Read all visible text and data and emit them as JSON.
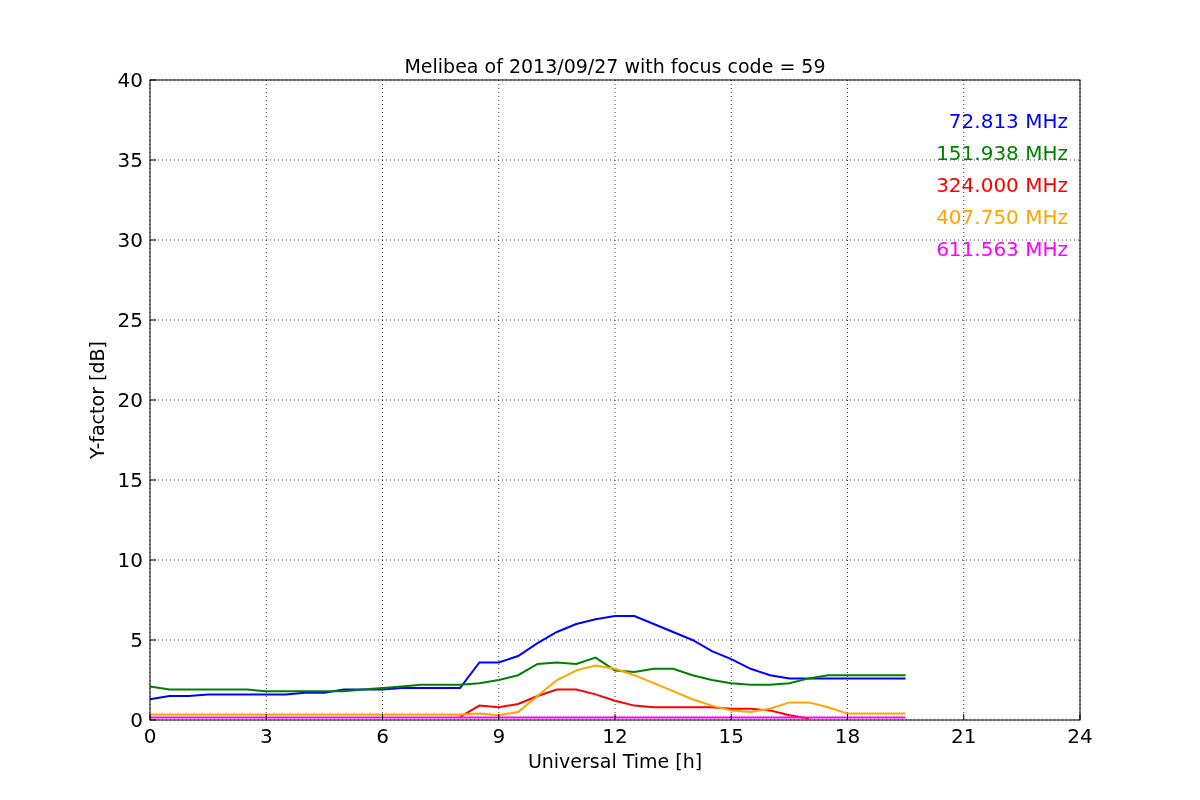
{
  "chart_data": {
    "type": "line",
    "title": "Melibea of 2013/09/27 with focus code = 59",
    "xlabel": "Universal Time [h]",
    "ylabel": "Y-factor [dB]",
    "x": [
      0,
      0.5,
      1,
      1.5,
      2,
      2.5,
      3,
      3.5,
      4,
      4.5,
      5,
      5.5,
      6,
      6.5,
      7,
      7.5,
      8,
      8.5,
      9,
      9.5,
      10,
      10.5,
      11,
      11.5,
      12,
      12.5,
      13,
      13.5,
      14,
      14.5,
      15,
      15.5,
      16,
      16.5,
      17,
      17.5,
      18,
      18.5,
      19,
      19.5
    ],
    "grid": true,
    "xlim": [
      0,
      24
    ],
    "ylim": [
      0,
      40
    ],
    "xticks": [
      0,
      3,
      6,
      9,
      12,
      15,
      18,
      21,
      24
    ],
    "yticks": [
      0,
      5,
      10,
      15,
      20,
      25,
      30,
      35,
      40
    ],
    "series": [
      {
        "name": "72.813 MHz",
        "color": "#0000ff",
        "values": [
          1.3,
          1.5,
          1.5,
          1.6,
          1.6,
          1.6,
          1.6,
          1.6,
          1.7,
          1.7,
          1.9,
          1.9,
          1.9,
          2.0,
          2.0,
          2.0,
          2.0,
          3.6,
          3.6,
          4.0,
          4.8,
          5.5,
          6.0,
          6.3,
          6.5,
          6.5,
          6.0,
          5.5,
          5.0,
          4.3,
          3.8,
          3.2,
          2.8,
          2.6,
          2.6,
          2.6,
          2.6,
          2.6,
          2.6,
          2.6
        ]
      },
      {
        "name": "151.938 MHz",
        "color": "#008000",
        "values": [
          2.1,
          1.9,
          1.9,
          1.9,
          1.9,
          1.9,
          1.8,
          1.8,
          1.8,
          1.8,
          1.8,
          1.9,
          2.0,
          2.1,
          2.2,
          2.2,
          2.2,
          2.3,
          2.5,
          2.8,
          3.5,
          3.6,
          3.5,
          3.9,
          3.1,
          3.0,
          3.2,
          3.2,
          2.8,
          2.5,
          2.3,
          2.2,
          2.2,
          2.3,
          2.6,
          2.8,
          2.8,
          2.8,
          2.8,
          2.8
        ]
      },
      {
        "name": "324.000 MHz",
        "color": "#ff0000",
        "values": [
          null,
          null,
          null,
          null,
          null,
          null,
          null,
          null,
          null,
          null,
          null,
          null,
          null,
          null,
          null,
          null,
          0.2,
          0.9,
          0.8,
          1.0,
          1.5,
          1.9,
          1.9,
          1.6,
          1.2,
          0.9,
          0.8,
          0.8,
          0.8,
          0.8,
          0.7,
          0.7,
          0.6,
          0.3,
          0.1,
          null,
          null,
          null,
          null,
          null
        ]
      },
      {
        "name": "407.750 MHz",
        "color": "#ffa500",
        "values": [
          0.35,
          0.35,
          0.35,
          0.35,
          0.35,
          0.35,
          0.35,
          0.35,
          0.35,
          0.35,
          0.35,
          0.35,
          0.35,
          0.35,
          0.35,
          0.35,
          0.35,
          0.4,
          0.3,
          0.5,
          1.5,
          2.5,
          3.1,
          3.4,
          3.2,
          2.8,
          2.3,
          1.8,
          1.3,
          0.9,
          0.6,
          0.5,
          0.7,
          1.1,
          1.1,
          0.8,
          0.4,
          0.4,
          0.4,
          0.4
        ]
      },
      {
        "name": "611.563 MHz",
        "color": "#ff00ff",
        "values": [
          0.15,
          0.15,
          0.15,
          0.15,
          0.15,
          0.15,
          0.15,
          0.15,
          0.15,
          0.15,
          0.15,
          0.15,
          0.15,
          0.15,
          0.15,
          0.15,
          0.15,
          0.15,
          0.15,
          0.15,
          0.15,
          0.15,
          0.15,
          0.15,
          0.15,
          0.15,
          0.15,
          0.15,
          0.15,
          0.15,
          0.15,
          0.15,
          0.15,
          0.15,
          0.15,
          0.15,
          0.15,
          0.15,
          0.15,
          0.15
        ]
      }
    ]
  }
}
